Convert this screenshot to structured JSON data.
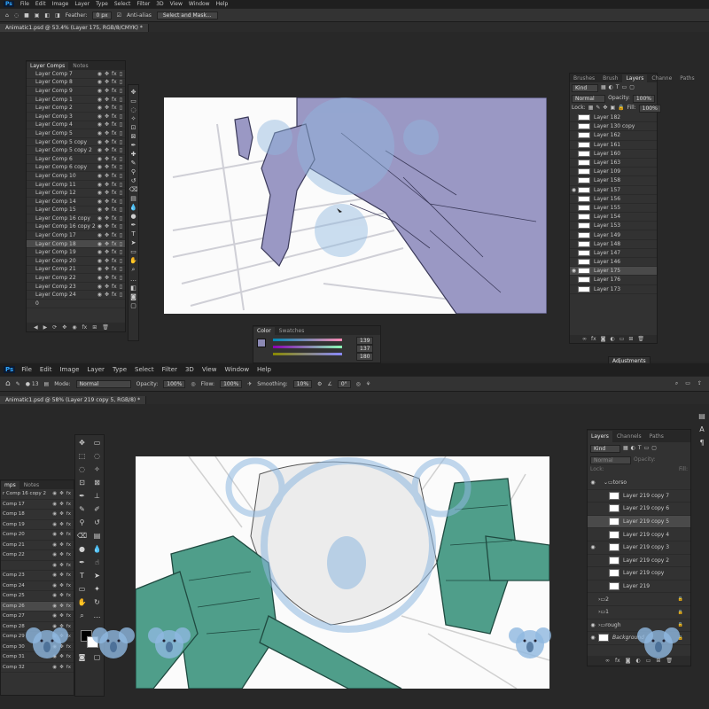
{
  "top": {
    "app_logo": "Ps",
    "menu": [
      "File",
      "Edit",
      "Image",
      "Layer",
      "Type",
      "Select",
      "Filter",
      "3D",
      "View",
      "Window",
      "Help"
    ],
    "options": {
      "feather_label": "Feather:",
      "feather_value": "0 px",
      "antialias": "Anti-alias",
      "select_mask": "Select and Mask..."
    },
    "doc_tab": "Animatic1.psd @ 53.4% (Layer 175, RGB/8/CMYK) *",
    "comps_panel": {
      "tabs": [
        "Layer Comps",
        "Notes"
      ],
      "items": [
        "Layer Comp 7",
        "Layer Comp 8",
        "Layer Comp 9",
        "Layer Comp 1",
        "Layer Comp 2",
        "Layer Comp 3",
        "Layer Comp 4",
        "Layer Comp 5",
        "Layer Comp 5 copy",
        "Layer Comp 5 copy 2",
        "Layer Comp 6",
        "Layer Comp 6 copy",
        "Layer Comp 10",
        "Layer Comp 11",
        "Layer Comp 12",
        "Layer Comp 14",
        "Layer Comp 15",
        "Layer Comp 16 copy",
        "Layer Comp 16 copy 2",
        "Layer Comp 17",
        "Layer Comp 18",
        "Layer Comp 19",
        "Layer Comp 20",
        "Layer Comp 21",
        "Layer Comp 22",
        "Layer Comp 23",
        "Layer Comp 24"
      ],
      "selected_index": 20,
      "last_unnamed": "0"
    },
    "layers_panel": {
      "tabs": [
        "Brushes",
        "Brush",
        "Layers",
        "Channe",
        "Paths"
      ],
      "kind": "Kind",
      "blend": "Normal",
      "opacity_label": "Opacity:",
      "opacity": "100%",
      "lock_label": "Lock:",
      "fill_label": "Fill:",
      "fill": "100%",
      "items": [
        "Layer 182",
        "Layer 130 copy",
        "Layer 162",
        "Layer 161",
        "Layer 160",
        "Layer 163",
        "Layer 109",
        "Layer 158",
        "Layer 157",
        "Layer 156",
        "Layer 155",
        "Layer 154",
        "Layer 153",
        "Layer 149",
        "Layer 148",
        "Layer 147",
        "Layer 146",
        "Layer 175",
        "Layer 176",
        "Layer 173"
      ],
      "selected_index": 17
    },
    "color_panel": {
      "tabs": [
        "Color",
        "Swatches"
      ],
      "r": "139",
      "g": "137",
      "b": "180"
    },
    "adjustments_tab": "Adjustments"
  },
  "bottom": {
    "app_logo": "Ps",
    "menu": [
      "File",
      "Edit",
      "Image",
      "Layer",
      "Type",
      "Select",
      "Filter",
      "3D",
      "View",
      "Window",
      "Help"
    ],
    "options": {
      "brush_size": "13",
      "mode_label": "Mode:",
      "mode": "Normal",
      "opacity_label": "Opacity:",
      "opacity": "100%",
      "flow_label": "Flow:",
      "flow": "100%",
      "smoothing_label": "Smoothing:",
      "smoothing": "10%",
      "angle": "0°"
    },
    "doc_tab": "Animatic1.psd @ 58% (Layer 219 copy 5, RGB/8) *",
    "comps_panel": {
      "tabs": [
        "mps",
        "Notes"
      ],
      "items": [
        "r Comp 16 copy 2",
        "Comp 17",
        "Comp 18",
        "Comp 19",
        "Comp 20",
        "Comp 21",
        "Comp 22",
        "",
        "Comp 23",
        "Comp 24",
        "Comp 25",
        "Comp 26",
        "Comp 27",
        "Comp 28",
        "Comp 29",
        "Comp 30",
        "Comp 31",
        "Comp 32"
      ],
      "selected_index": 11
    },
    "layers_panel": {
      "tabs": [
        "Layers",
        "Channels",
        "Paths"
      ],
      "kind": "Kind",
      "blend": "Normal",
      "opacity_label": "Opacity:",
      "lock_label": "Lock:",
      "fill_label": "Fill:",
      "items": [
        {
          "name": "torso",
          "type": "group",
          "indent": 1
        },
        {
          "name": "Layer 219 copy 7",
          "type": "layer",
          "indent": 2
        },
        {
          "name": "Layer 219 copy 6",
          "type": "layer",
          "indent": 2
        },
        {
          "name": "Layer 219 copy 5",
          "type": "layer",
          "indent": 2
        },
        {
          "name": "Layer 219 copy 4",
          "type": "layer",
          "indent": 2
        },
        {
          "name": "Layer 219 copy 3",
          "type": "layer",
          "indent": 2
        },
        {
          "name": "Layer 219 copy 2",
          "type": "layer",
          "indent": 2
        },
        {
          "name": "Layer 219 copy",
          "type": "layer",
          "indent": 2
        },
        {
          "name": "Layer 219",
          "type": "layer",
          "indent": 2
        },
        {
          "name": "2",
          "type": "group",
          "indent": 0
        },
        {
          "name": "1",
          "type": "group",
          "indent": 0
        },
        {
          "name": "rough",
          "type": "group",
          "indent": 0
        },
        {
          "name": "Background",
          "type": "background",
          "indent": 0
        }
      ],
      "selected_index": 3
    }
  },
  "colors": {
    "accent": "#31a8ff",
    "watermark": "#8fb8e0",
    "top_ink": "#7c7aa8",
    "bottom_ink": "#3f8a7a"
  }
}
